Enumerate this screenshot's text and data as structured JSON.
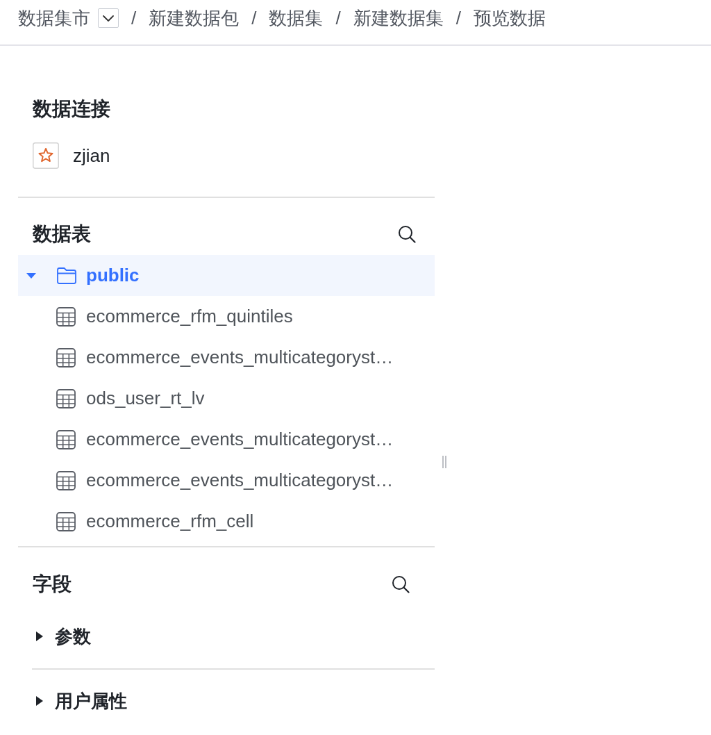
{
  "breadcrumb": [
    {
      "kind": "crumb",
      "text": "数据集市",
      "dropdown": true
    },
    {
      "kind": "separator",
      "text": "/"
    },
    {
      "kind": "crumb",
      "text": "新建数据包",
      "dropdown": false
    },
    {
      "kind": "separator",
      "text": "/"
    },
    {
      "kind": "crumb",
      "text": "数据集",
      "dropdown": false
    },
    {
      "kind": "separator",
      "text": "/"
    },
    {
      "kind": "crumb",
      "text": "新建数据集",
      "dropdown": false
    },
    {
      "kind": "separator",
      "text": "/"
    },
    {
      "kind": "crumb",
      "text": "预览数据",
      "dropdown": false
    }
  ],
  "connections": {
    "title": "数据连接",
    "items": [
      {
        "name": "zjian"
      }
    ]
  },
  "tables": {
    "title": "数据表",
    "tree": [
      {
        "name": "public",
        "kind": "schema",
        "expanded": true,
        "selected": true,
        "children": [
          {
            "name": "ecommerce_rfm_quintiles",
            "kind": "table",
            "selected": false
          },
          {
            "name": "ecommerce_events_multicategoryst…",
            "kind": "table",
            "selected": false
          },
          {
            "name": "ods_user_rt_lv",
            "kind": "table",
            "selected": false
          },
          {
            "name": "ecommerce_events_multicategoryst…",
            "kind": "table",
            "selected": false
          },
          {
            "name": "ecommerce_events_multicategoryst…",
            "kind": "table",
            "selected": false
          },
          {
            "name": "ecommerce_rfm_cell",
            "kind": "table",
            "selected": false
          }
        ]
      }
    ]
  },
  "fields": {
    "title": "字段",
    "groups": [
      {
        "name": "参数",
        "expanded": false
      },
      {
        "name": "用户属性",
        "expanded": false
      }
    ]
  }
}
